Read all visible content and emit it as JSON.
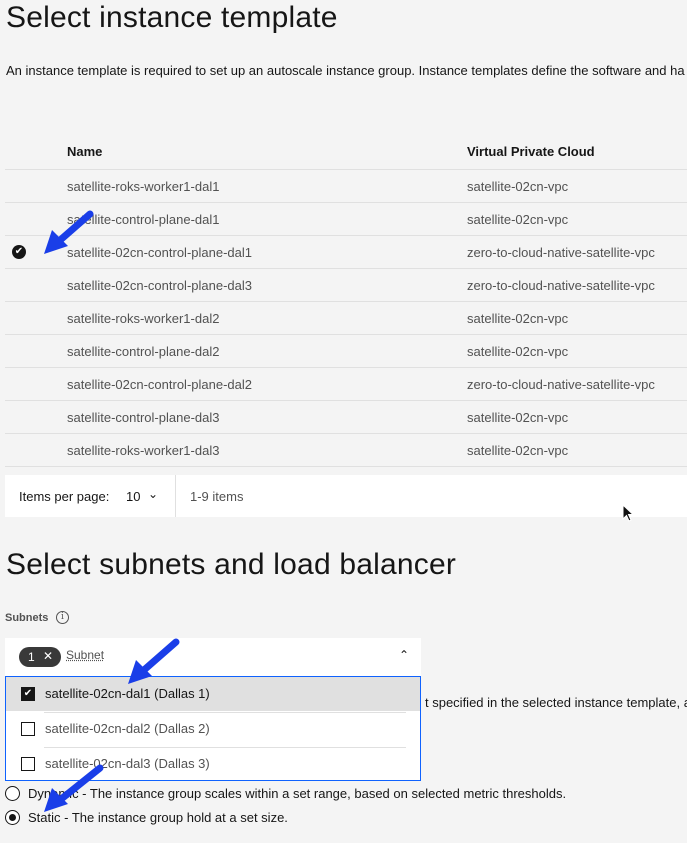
{
  "template_section": {
    "title": "Select instance template",
    "description": "An instance template is required to set up an autoscale instance group. Instance templates define the software and ha",
    "columns": {
      "name": "Name",
      "vpc": "Virtual Private Cloud"
    },
    "rows": [
      {
        "name": "satellite-roks-worker1-dal1",
        "vpc": "satellite-02cn-vpc",
        "selected": false
      },
      {
        "name": "satellite-control-plane-dal1",
        "vpc": "satellite-02cn-vpc",
        "selected": false
      },
      {
        "name": "satellite-02cn-control-plane-dal1",
        "vpc": "zero-to-cloud-native-satellite-vpc",
        "selected": true
      },
      {
        "name": "satellite-02cn-control-plane-dal3",
        "vpc": "zero-to-cloud-native-satellite-vpc",
        "selected": false
      },
      {
        "name": "satellite-roks-worker1-dal2",
        "vpc": "satellite-02cn-vpc",
        "selected": false
      },
      {
        "name": "satellite-control-plane-dal2",
        "vpc": "satellite-02cn-vpc",
        "selected": false
      },
      {
        "name": "satellite-02cn-control-plane-dal2",
        "vpc": "zero-to-cloud-native-satellite-vpc",
        "selected": false
      },
      {
        "name": "satellite-control-plane-dal3",
        "vpc": "satellite-02cn-vpc",
        "selected": false
      },
      {
        "name": "satellite-roks-worker1-dal3",
        "vpc": "satellite-02cn-vpc",
        "selected": false
      }
    ],
    "pagination": {
      "items_per_page_label": "Items per page:",
      "items_per_page": "10",
      "range": "1-9 items"
    }
  },
  "subnet_section": {
    "title": "Select subnets and load balancer",
    "subnets_label": "Subnets",
    "tag_count": "1",
    "placeholder": "Subnet",
    "options": [
      {
        "label": "satellite-02cn-dal1 (Dallas 1)",
        "checked": true
      },
      {
        "label": "satellite-02cn-dal2 (Dallas 2)",
        "checked": false
      },
      {
        "label": "satellite-02cn-dal3 (Dallas 3)",
        "checked": false
      }
    ],
    "hidden_text": "t specified in the selected instance template, a",
    "radios": [
      {
        "label": "Dynamic - The instance group scales within a set range, based on selected metric thresholds.",
        "checked": false
      },
      {
        "label": "Static - The instance group hold at a set size.",
        "checked": true
      }
    ]
  },
  "colors": {
    "accent": "#0f62fe",
    "arrow": "#1a3ee8"
  }
}
